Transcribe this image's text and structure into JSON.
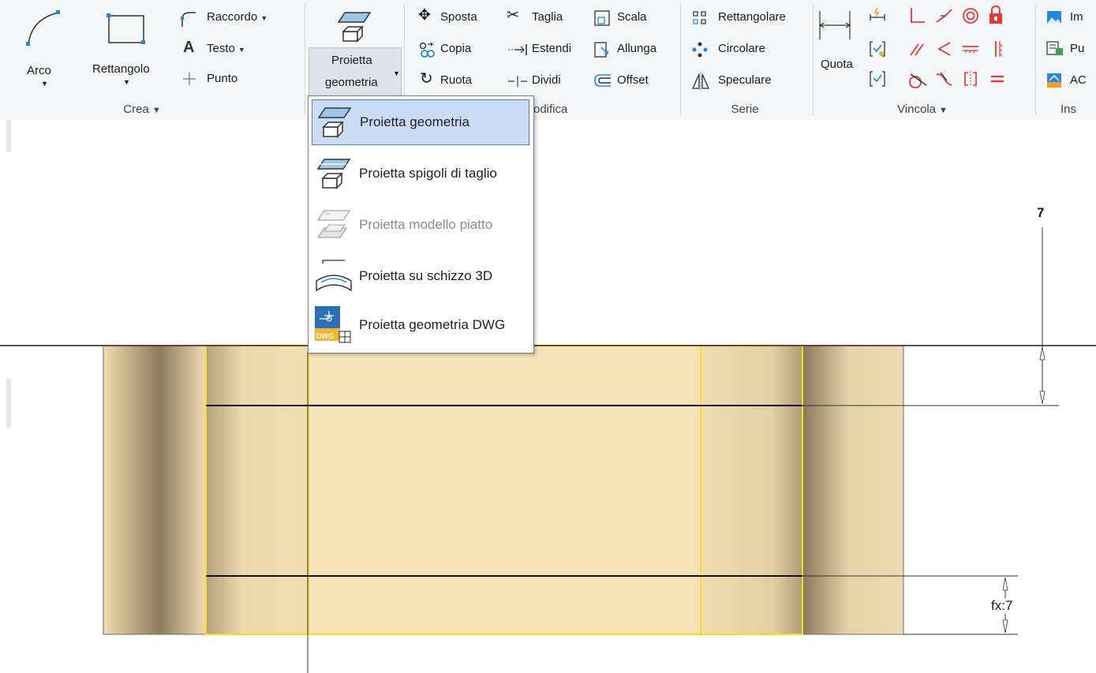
{
  "ribbon": {
    "crea": {
      "arco": "Arco",
      "rettangolo": "Rettangolo",
      "raccordo": "Raccordo",
      "testo": "Testo",
      "punto": "Punto",
      "title": "Crea"
    },
    "proietta": {
      "line1": "Proietta",
      "line2": "geometria"
    },
    "modifica": {
      "sposta": "Sposta",
      "taglia": "Taglia",
      "scala": "Scala",
      "copia": "Copia",
      "estendi": "Estendi",
      "allunga": "Allunga",
      "ruota": "Ruota",
      "dividi": "Dividi",
      "offset": "Offset",
      "title_visible": "odifica"
    },
    "serie": {
      "rettangolare": "Rettangolare",
      "circolare": "Circolare",
      "speculare": "Speculare",
      "title": "Serie"
    },
    "vincola": {
      "quota": "Quota",
      "title": "Vincola"
    },
    "inserisci": {
      "item1": "Im",
      "item2": "Pu",
      "item3": "AC",
      "title": "Ins"
    }
  },
  "dropdown": {
    "items": [
      {
        "label": "Proietta geometria",
        "state": "selected"
      },
      {
        "label": "Proietta spigoli di taglio",
        "state": "normal"
      },
      {
        "label": "Proietta modello piatto",
        "state": "disabled"
      },
      {
        "label": "Proietta su schizzo 3D",
        "state": "normal"
      },
      {
        "label": "Proietta geometria DWG",
        "state": "normal"
      }
    ]
  },
  "sketch": {
    "dim_top": "7",
    "dim_bottom": "fx:7"
  },
  "colors": {
    "ribbon_bg": "#f5f6f7",
    "part_fill": "#f5e2b8",
    "projected_edge": "#f0e020",
    "selection_bg": "#c9dcf2",
    "selection_border": "#4a86c8"
  }
}
